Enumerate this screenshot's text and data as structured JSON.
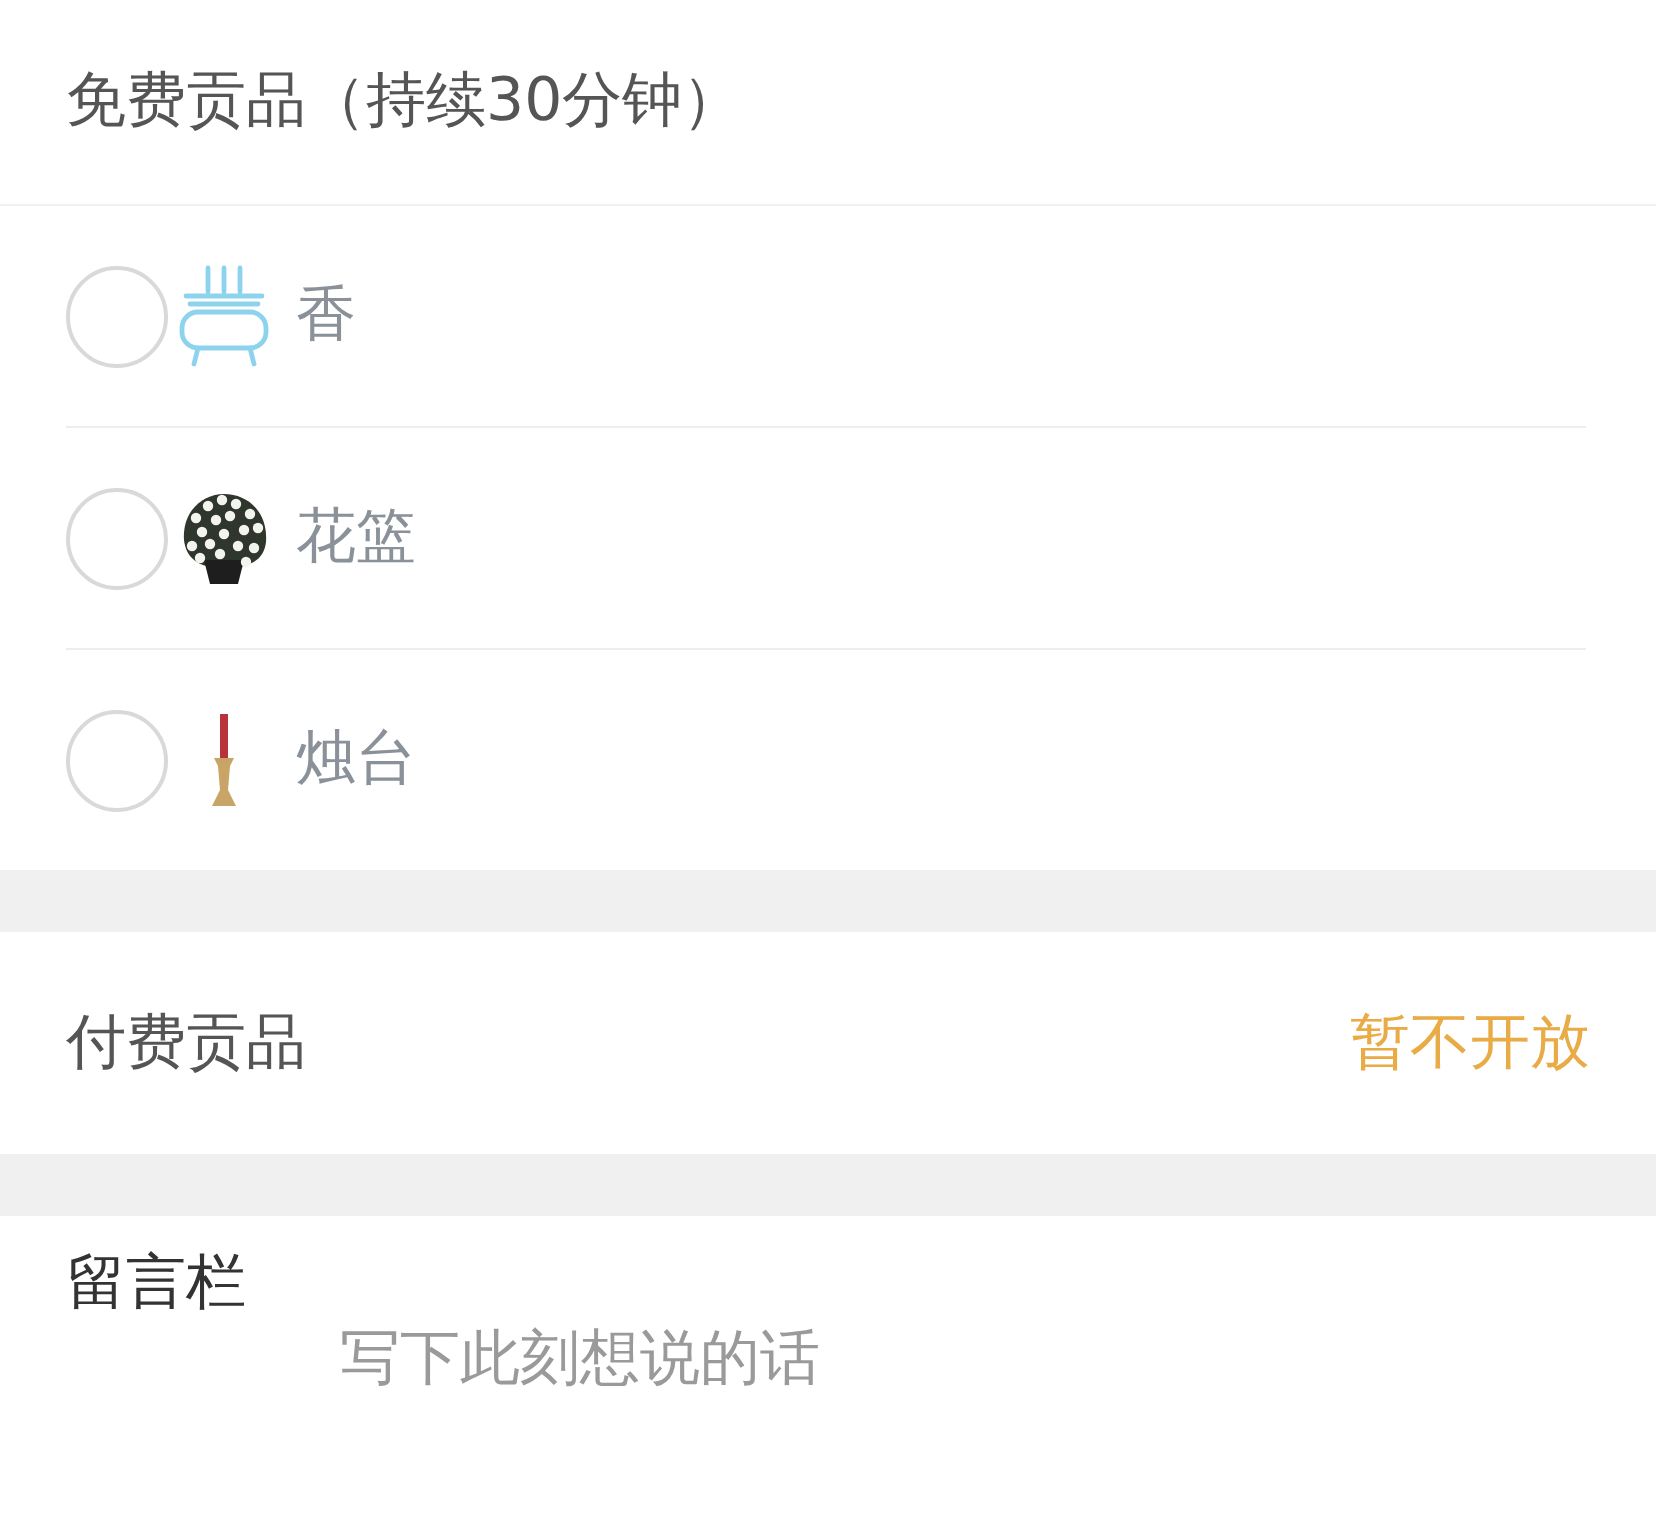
{
  "free_offerings": {
    "title": "免费贡品（持续30分钟）",
    "items": [
      {
        "label": "香",
        "selected": false
      },
      {
        "label": "花篮",
        "selected": false
      },
      {
        "label": "烛台",
        "selected": false
      }
    ]
  },
  "paid_offerings": {
    "title": "付费贡品",
    "status": "暂不开放"
  },
  "message": {
    "title": "留言栏",
    "placeholder": "写下此刻想说的话"
  }
}
